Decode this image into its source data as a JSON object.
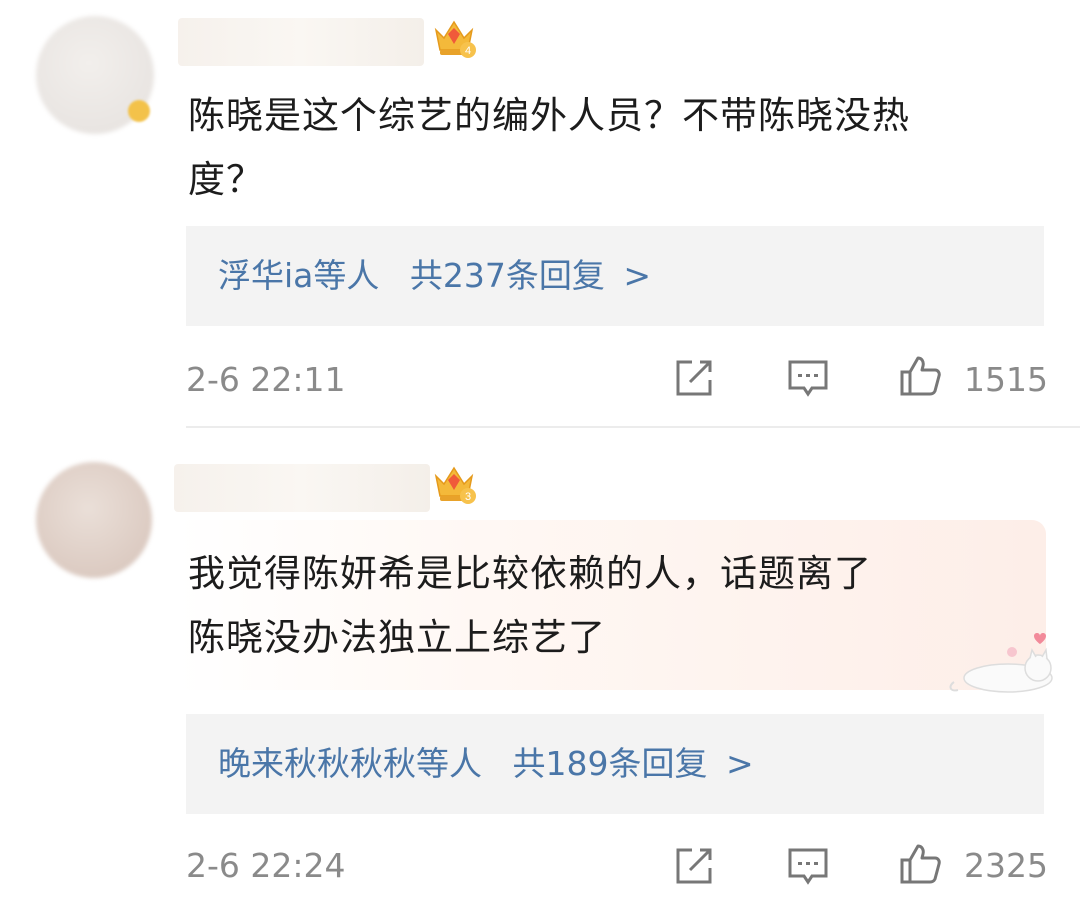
{
  "comments": [
    {
      "text_line1": "陈晓是这个综艺的编外人员？不带陈晓没热",
      "text_line2": "度？",
      "level_badge": "4",
      "replies": {
        "users": "浮华ia等人",
        "count": "共237条回复",
        "chevron": ">"
      },
      "time": "2-6 22:11",
      "likes": "1515",
      "icons": {
        "share": "share-icon",
        "comment": "comment-icon",
        "like": "thumbs-up-icon",
        "crown": "crown-icon"
      }
    },
    {
      "text_line1": "我觉得陈妍希是比较依赖的人，话题离了",
      "text_line2": "陈晓没办法独立上综艺了",
      "level_badge": "3",
      "replies": {
        "users": "晚来秋秋秋秋等人",
        "count": "共189条回复",
        "chevron": ">"
      },
      "time": "2-6 22:24",
      "likes": "2325",
      "icons": {
        "share": "share-icon",
        "comment": "comment-icon",
        "like": "thumbs-up-icon",
        "crown": "crown-icon",
        "decoration": "cat-sticker-icon"
      }
    }
  ],
  "colors": {
    "link": "#4a76a8",
    "meta": "#8a8a8a",
    "reply_bg": "#f3f3f3"
  }
}
